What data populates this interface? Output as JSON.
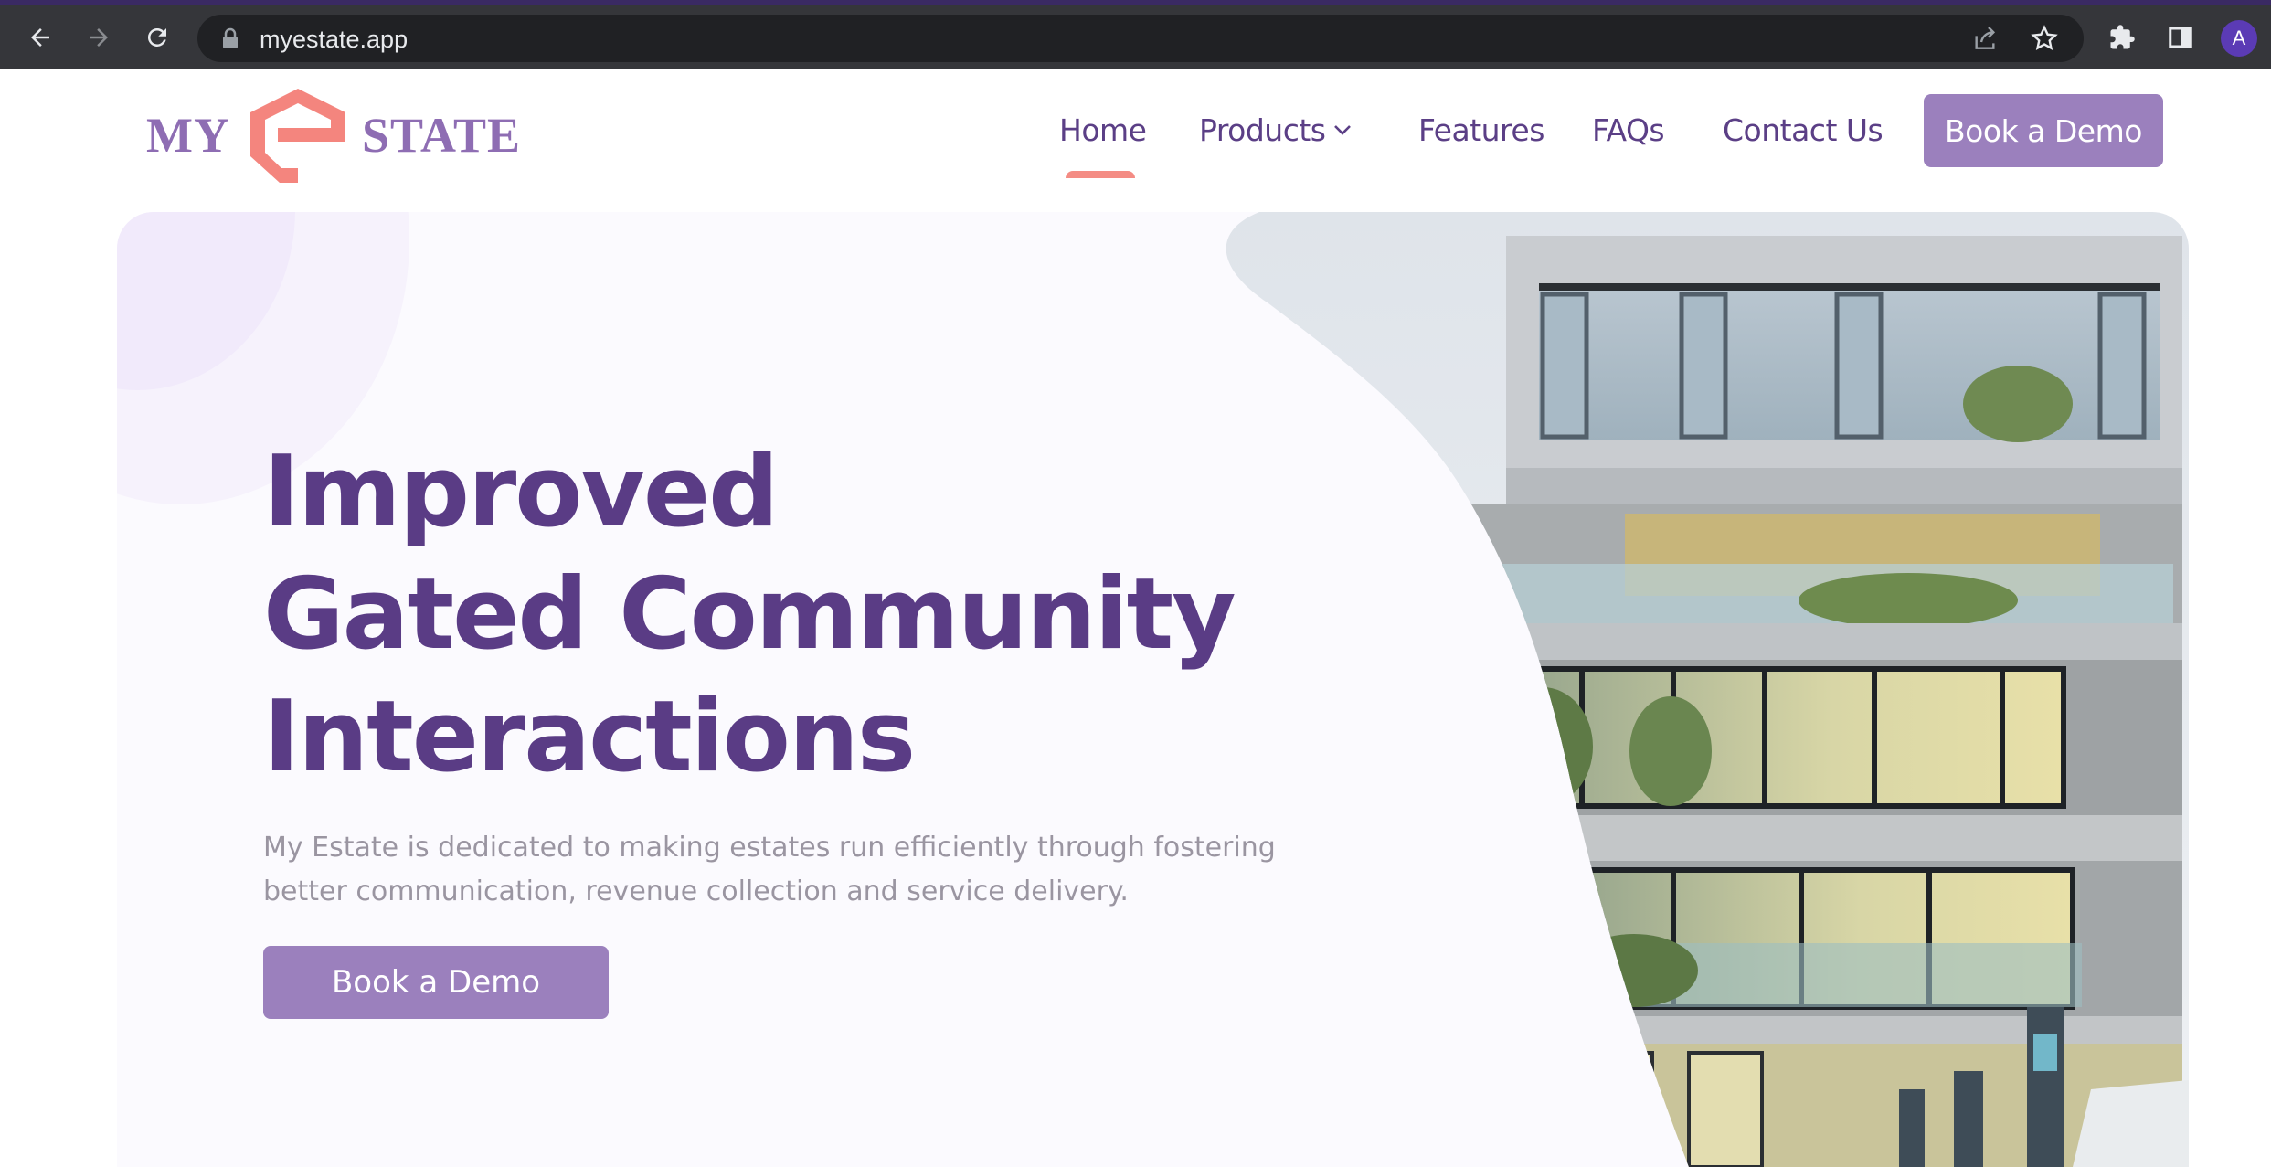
{
  "browser": {
    "url": "myestate.app",
    "profile_initial": "A",
    "icons": [
      "back-arrow-icon",
      "forward-arrow-icon",
      "reload-icon",
      "lock-icon",
      "share-icon",
      "star-icon",
      "extensions-icon",
      "side-panel-icon"
    ]
  },
  "logo": {
    "left_word": "MY",
    "right_word": "STATE",
    "colors": {
      "mark": "#f4857e",
      "text": "#8e6db3"
    }
  },
  "nav": {
    "items": [
      {
        "label": "Home",
        "active": true
      },
      {
        "label": "Products",
        "dropdown": true
      },
      {
        "label": "Features"
      },
      {
        "label": "FAQs"
      },
      {
        "label": "Contact Us"
      }
    ],
    "cta_label": "Book a Demo"
  },
  "hero": {
    "title_lines": [
      "Improved",
      "Gated Community",
      "Interactions"
    ],
    "description": "My Estate is dedicated to making estates run efficiently through fostering better communication, revenue collection and service delivery.",
    "cta_label": "Book a Demo"
  },
  "colors": {
    "brand_purple": "#5a3c85",
    "button_purple": "#9b80bd",
    "accent_coral": "#f48c84",
    "hero_bg": "#fbfafe"
  }
}
